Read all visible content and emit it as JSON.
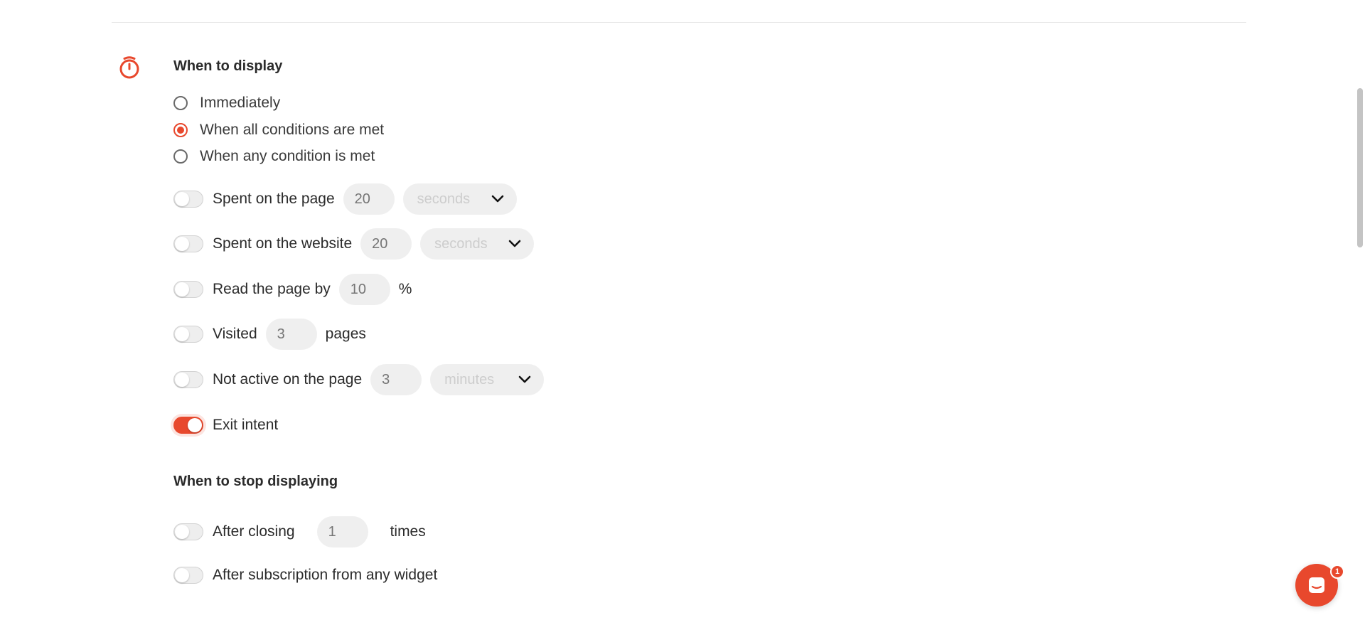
{
  "colors": {
    "accent": "#e8482d",
    "text": "#2b2b2b",
    "input_bg": "#efefef",
    "placeholder": "#cdcdcd"
  },
  "display": {
    "icon": "stopwatch-icon",
    "heading": "When to display",
    "mode_options": [
      {
        "label": "Immediately",
        "checked": false
      },
      {
        "label": "When all conditions are met",
        "checked": true
      },
      {
        "label": "When any condition is met",
        "checked": false
      }
    ],
    "conditions": {
      "time_on_page": {
        "label": "Spent on the page",
        "enabled": false,
        "value": "20",
        "unit": "seconds"
      },
      "time_on_site": {
        "label": "Spent on the website",
        "enabled": false,
        "value": "20",
        "unit": "seconds"
      },
      "scroll_depth": {
        "label": "Read the page by",
        "enabled": false,
        "value": "10",
        "suffix": "%"
      },
      "pages_visited": {
        "label": "Visited",
        "enabled": false,
        "value": "3",
        "suffix": "pages"
      },
      "inactivity": {
        "label": "Not active on the page",
        "enabled": false,
        "value": "3",
        "unit": "minutes"
      },
      "exit_intent": {
        "label": "Exit intent",
        "enabled": true
      }
    }
  },
  "stop_display": {
    "heading": "When to stop displaying",
    "after_closing": {
      "label": "After closing",
      "enabled": false,
      "value": "1",
      "suffix": "times"
    },
    "after_subscription": {
      "label": "After subscription from any widget",
      "enabled": false
    }
  },
  "chat": {
    "icon": "chat-icon",
    "badge_count": "1"
  }
}
